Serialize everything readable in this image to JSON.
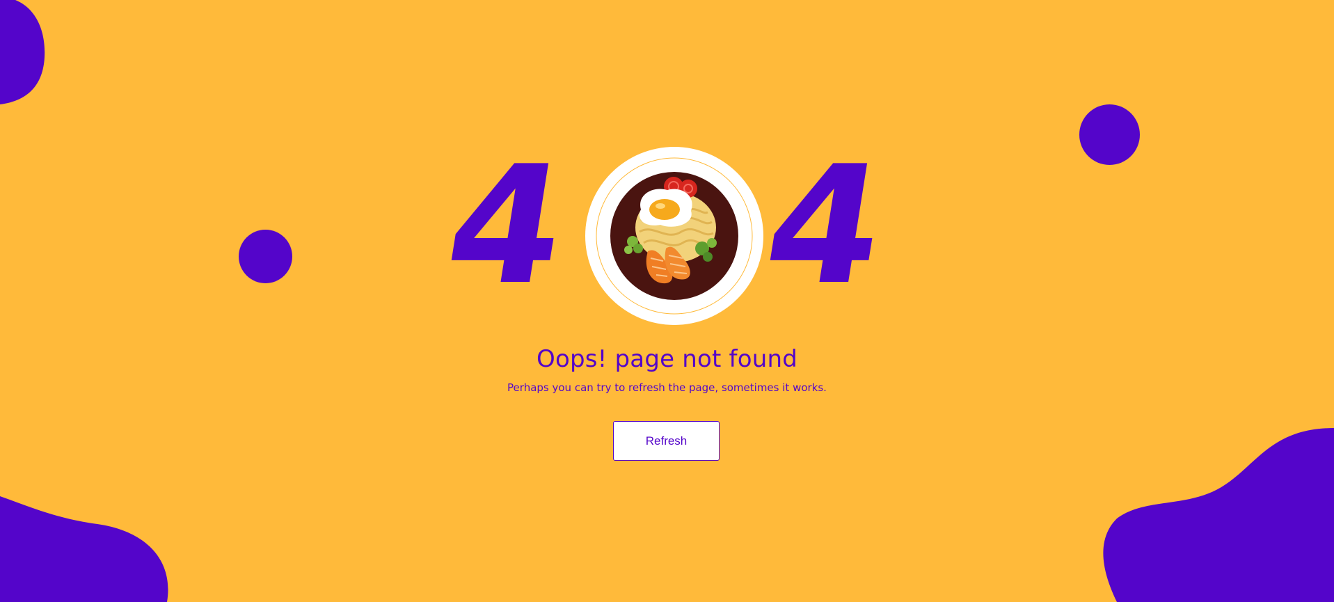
{
  "error": {
    "digit_left": "4",
    "digit_right": "4",
    "zero_image": "food-plate-illustration"
  },
  "message": {
    "title": "Oops! page not found",
    "subtitle": "Perhaps you can try to refresh the page, sometimes it works."
  },
  "actions": {
    "refresh_label": "Refresh"
  },
  "colors": {
    "background": "#FFBA3A",
    "accent": "#5405CA",
    "button_background": "#FFFFFF"
  }
}
